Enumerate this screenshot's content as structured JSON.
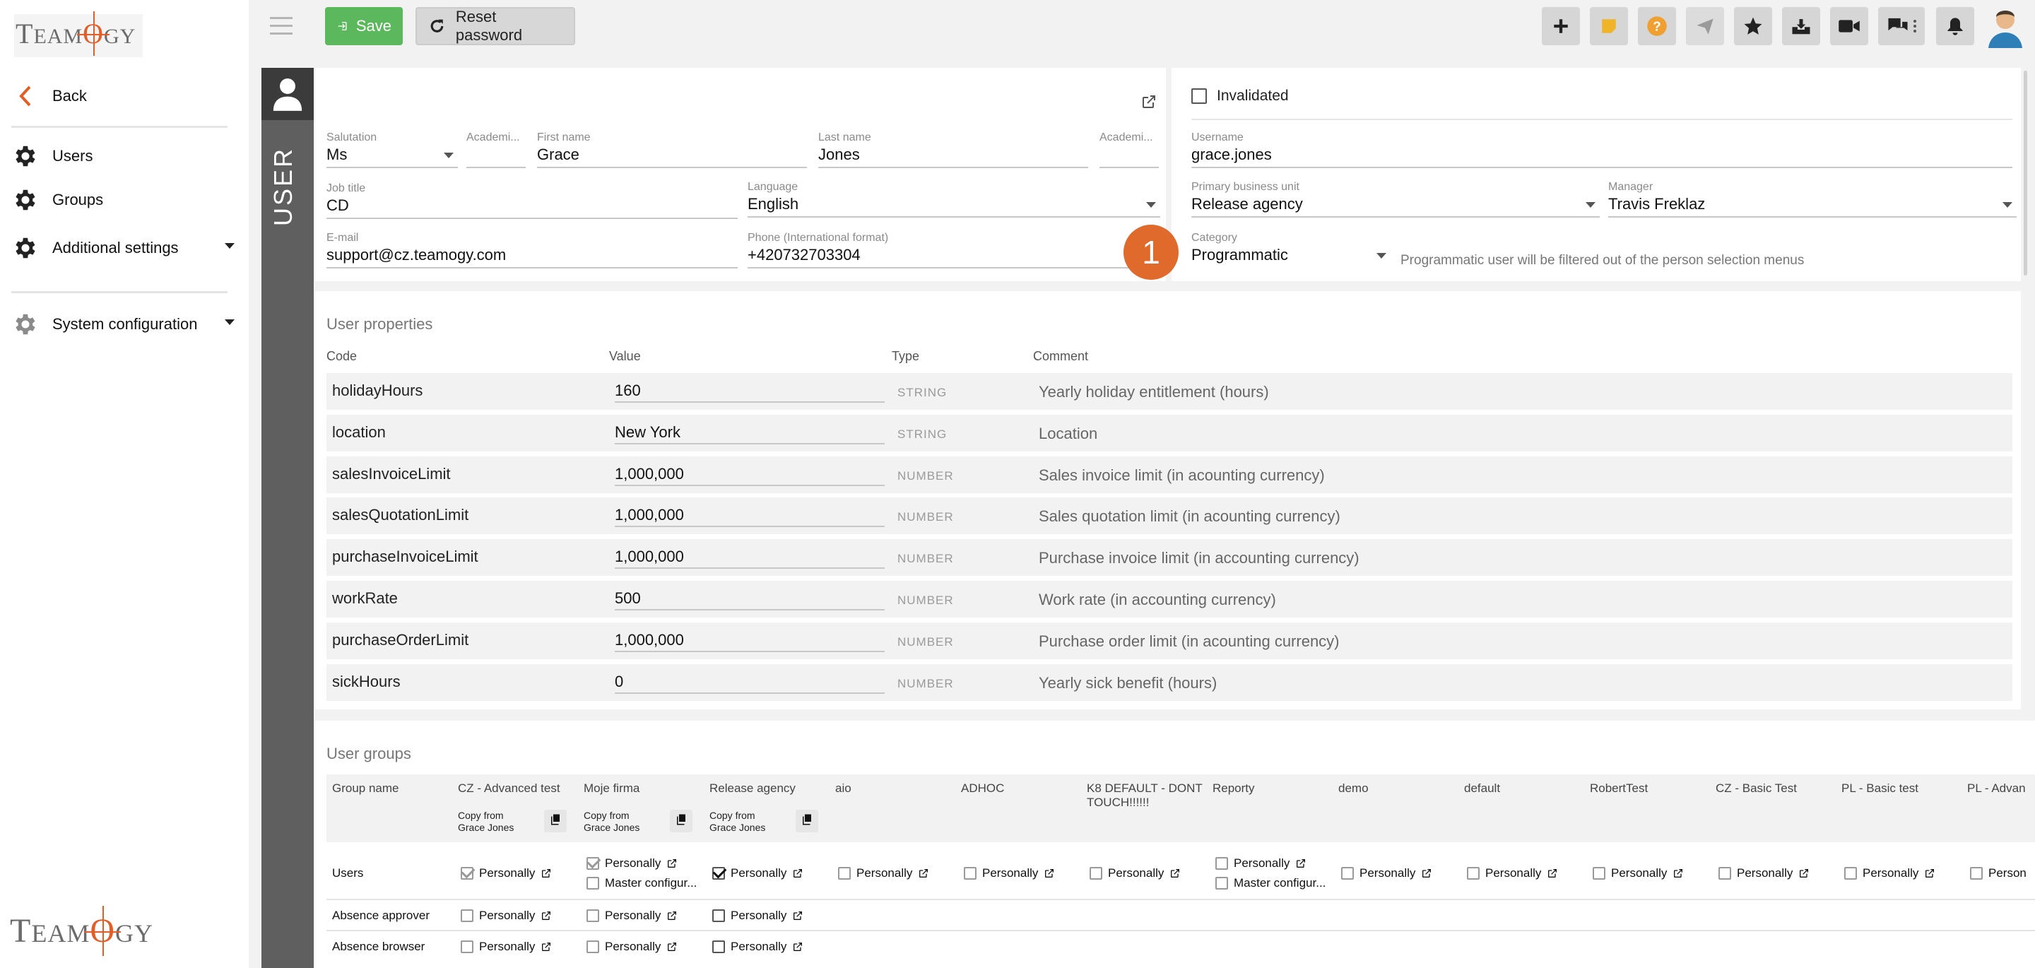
{
  "sidebar": {
    "logo": "TEAMOGY",
    "back": "Back",
    "items": [
      {
        "label": "Users",
        "icon": "gear-icon"
      },
      {
        "label": "Groups",
        "icon": "gear-icon"
      },
      {
        "label": "Additional settings",
        "icon": "gear-icon"
      },
      {
        "label": "System configuration",
        "icon": "gear-icon"
      }
    ]
  },
  "toolbar": {
    "save_label": "Save",
    "reset_label": "Reset password"
  },
  "user_tab_label": "USER",
  "form": {
    "salutation": {
      "label": "Salutation",
      "value": "Ms"
    },
    "academic_before": {
      "label": "Academi...",
      "value": ""
    },
    "first_name": {
      "label": "First name",
      "value": "Grace"
    },
    "last_name": {
      "label": "Last name",
      "value": "Jones"
    },
    "academic_after": {
      "label": "Academi...",
      "value": ""
    },
    "job_title": {
      "label": "Job title",
      "value": "CD"
    },
    "language": {
      "label": "Language",
      "value": "English"
    },
    "email": {
      "label": "E-mail",
      "value": "support@cz.teamogy.com"
    },
    "phone": {
      "label": "Phone (International format)",
      "value": "+420732703304"
    },
    "invalidated": "Invalidated",
    "username": {
      "label": "Username",
      "value": "grace.jones"
    },
    "business_unit": {
      "label": "Primary business unit",
      "value": "Release agency"
    },
    "manager": {
      "label": "Manager",
      "value": "Travis Freklaz"
    },
    "category": {
      "label": "Category",
      "value": "Programmatic"
    },
    "category_note": "Programmatic user will be filtered out of the person selection menus",
    "badge": "1"
  },
  "properties": {
    "title": "User properties",
    "headers": {
      "code": "Code",
      "value": "Value",
      "type": "Type",
      "comment": "Comment"
    },
    "rows": [
      {
        "code": "holidayHours",
        "value": "160",
        "type": "STRING",
        "comment": "Yearly holiday entitlement (hours)"
      },
      {
        "code": "location",
        "value": "New York",
        "type": "STRING",
        "comment": "Location"
      },
      {
        "code": "salesInvoiceLimit",
        "value": "1,000,000",
        "type": "NUMBER",
        "comment": "Sales invoice limit (in acounting currency)"
      },
      {
        "code": "salesQuotationLimit",
        "value": "1,000,000",
        "type": "NUMBER",
        "comment": "Sales quotation limit (in acounting currency)"
      },
      {
        "code": "purchaseInvoiceLimit",
        "value": "1,000,000",
        "type": "NUMBER",
        "comment": "Purchase invoice limit (in accounting currency)"
      },
      {
        "code": "workRate",
        "value": "500",
        "type": "NUMBER",
        "comment": "Work rate (in accounting currency)"
      },
      {
        "code": "purchaseOrderLimit",
        "value": "1,000,000",
        "type": "NUMBER",
        "comment": "Purchase order limit (in acounting currency)"
      },
      {
        "code": "sickHours",
        "value": "0",
        "type": "NUMBER",
        "comment": "Yearly sick benefit (hours)"
      }
    ]
  },
  "groups": {
    "title": "User groups",
    "name_header": "Group name",
    "columns": [
      "CZ - Advanced test",
      "Moje firma",
      "Release agency",
      "aio",
      "ADHOC",
      "K8 DEFAULT - DONT TOUCH!!!!!!",
      "Reporty",
      "demo",
      "default",
      "RobertTest",
      "CZ - Basic Test",
      "PL - Basic test",
      "PL - Advan"
    ],
    "copy_from": "Copy from",
    "copy_name": "Grace Jones",
    "personally": "Personally",
    "master": "Master configur...",
    "personally_cut": "Person",
    "rows": [
      "Users",
      "Absence approver",
      "Absence browser"
    ]
  }
}
